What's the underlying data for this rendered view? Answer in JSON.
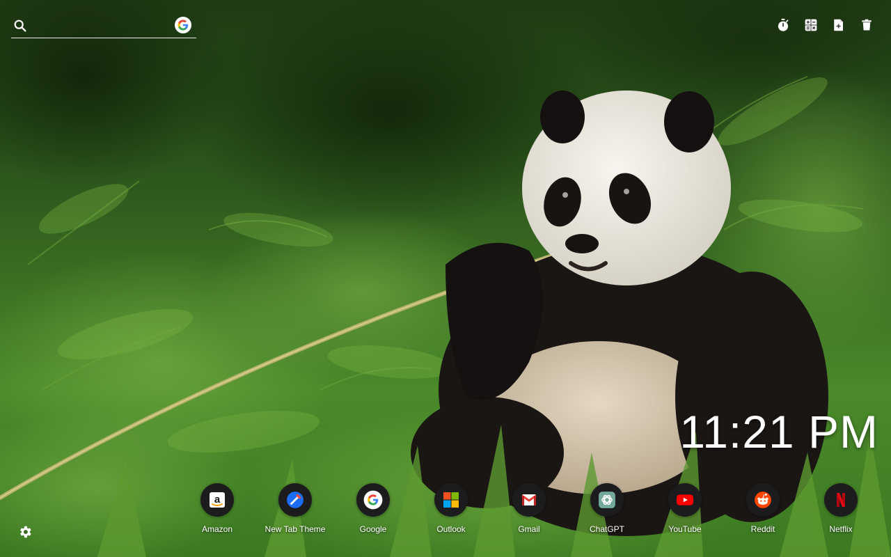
{
  "search": {
    "placeholder": "",
    "icon": "search-icon",
    "engine_icon": "google-icon"
  },
  "toolbar": {
    "items": [
      {
        "icon": "stopwatch-icon"
      },
      {
        "icon": "calculator-icon"
      },
      {
        "icon": "add-note-icon"
      },
      {
        "icon": "trash-icon"
      }
    ]
  },
  "clock": {
    "time": "11:21 PM"
  },
  "dock": {
    "items": [
      {
        "label": "Amazon",
        "icon": "amazon-icon"
      },
      {
        "label": "New Tab Theme",
        "icon": "new-tab-theme-icon"
      },
      {
        "label": "Google",
        "icon": "google-icon"
      },
      {
        "label": "Outlook",
        "icon": "microsoft-icon"
      },
      {
        "label": "Gmail",
        "icon": "gmail-icon"
      },
      {
        "label": "ChatGPT",
        "icon": "chatgpt-icon"
      },
      {
        "label": "YouTube",
        "icon": "youtube-icon"
      },
      {
        "label": "Reddit",
        "icon": "reddit-icon"
      },
      {
        "label": "Netflix",
        "icon": "netflix-icon"
      }
    ]
  },
  "settings": {
    "icon": "gear-icon"
  },
  "colors": {
    "dock_circle": "#1c1c1e",
    "text": "#ffffff",
    "foliage": "#3f7a23"
  }
}
